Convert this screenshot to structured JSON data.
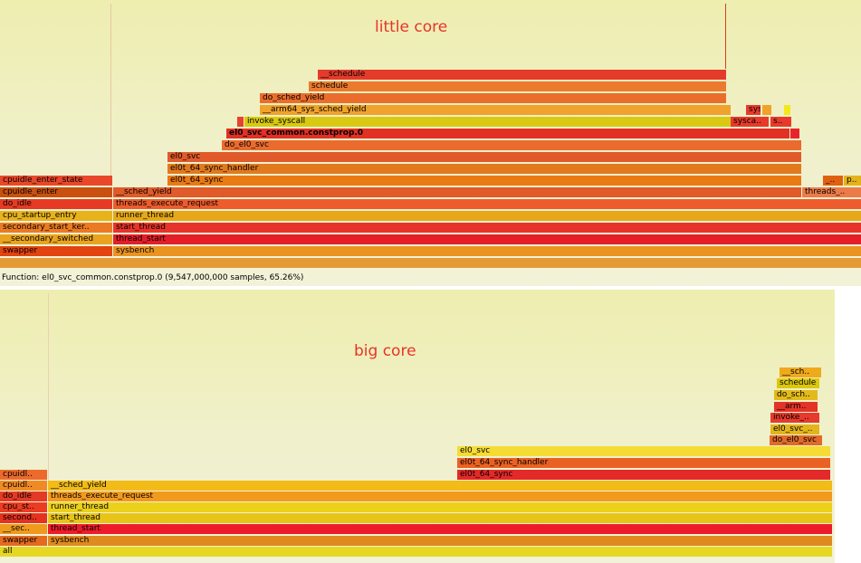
{
  "top": {
    "title": "little core",
    "status": "Function: el0_svc_common.constprop.0 (9,547,000,000 samples, 65.26%)",
    "frames": [
      {
        "label": "__schedule",
        "color": "#e43b2b"
      },
      {
        "label": "schedule",
        "color": "#ec7a2e"
      },
      {
        "label": "do_sched_yield",
        "color": "#ea6d2c"
      },
      {
        "label": "__arm64_sys_sched_yield",
        "color": "#f0a22c"
      },
      {
        "label": "invoke_syscall",
        "color": "#d9c912"
      },
      {
        "label": "sysca..",
        "color": "#e83a2c"
      },
      {
        "label": "s..",
        "color": "#e83a2c"
      },
      {
        "label": "el0_svc_common.constprop.0",
        "color": "#e23025"
      },
      {
        "label": "do_el0_svc",
        "color": "#ea6b2e"
      },
      {
        "label": "el0_svc",
        "color": "#e05a2a"
      },
      {
        "label": "el0t_64_sync_handler",
        "color": "#e27a1d"
      },
      {
        "label": "el0t_64_sync",
        "color": "#ea7a14"
      },
      {
        "label": "_..",
        "color": "#e06010"
      },
      {
        "label": "p..",
        "color": "#e4b31a"
      },
      {
        "label": "cpuidle_enter_state",
        "color": "#e8472a"
      },
      {
        "label": "cpuidle_enter",
        "color": "#c9500f"
      },
      {
        "label": "__sched_yield",
        "color": "#e05a2a"
      },
      {
        "label": "threads_..",
        "color": "#ec7b4a"
      },
      {
        "label": "do_idle",
        "color": "#e63a24"
      },
      {
        "label": "threads_execute_request",
        "color": "#ee5c2d"
      },
      {
        "label": "cpu_startup_entry",
        "color": "#e7b21c"
      },
      {
        "label": "runner_thread",
        "color": "#e6a818"
      },
      {
        "label": "secondary_start_ker..",
        "color": "#ec7a22"
      },
      {
        "label": "start_thread",
        "color": "#e8332a"
      },
      {
        "label": "__secondary_switched",
        "color": "#e9a31e"
      },
      {
        "label": "thread_start",
        "color": "#e41e29"
      },
      {
        "label": "swapper",
        "color": "#e2430f"
      },
      {
        "label": "sysbench",
        "color": "#ea9321"
      },
      {
        "label": "",
        "color": "#e59b35"
      }
    ]
  },
  "bottom": {
    "title": "big core",
    "frames": [
      {
        "label": "__sch..",
        "color": "#efa91c"
      },
      {
        "label": "schedule",
        "color": "#dcc70e"
      },
      {
        "label": "do_sch..",
        "color": "#e2ba1b"
      },
      {
        "label": "__arm..",
        "color": "#e43327"
      },
      {
        "label": "invoke_..",
        "color": "#e53a2d"
      },
      {
        "label": "el0_svc_..",
        "color": "#e2b51c"
      },
      {
        "label": "do_el0_svc",
        "color": "#e06a2a"
      },
      {
        "label": "el0_svc",
        "color": "#f5dc35"
      },
      {
        "label": "el0t_64_sync_handler",
        "color": "#ea6223"
      },
      {
        "label": "el0t_64_sync",
        "color": "#e42929"
      },
      {
        "label": "cpuidl..",
        "color": "#ec6a2c"
      },
      {
        "label": "cpuidl..",
        "color": "#f08a24"
      },
      {
        "label": "__sched_yield",
        "color": "#f2bb18"
      },
      {
        "label": "do_idle",
        "color": "#e43a25"
      },
      {
        "label": "threads_execute_request",
        "color": "#f29a1e"
      },
      {
        "label": "cpu_st..",
        "color": "#ea3c22"
      },
      {
        "label": "runner_thread",
        "color": "#ebd01c"
      },
      {
        "label": "second..",
        "color": "#e4321f"
      },
      {
        "label": "start_thread",
        "color": "#e8c418"
      },
      {
        "label": "__sec..",
        "color": "#ef9a1d"
      },
      {
        "label": "thread_start",
        "color": "#ee1c2a"
      },
      {
        "label": "swapper",
        "color": "#e56a1f"
      },
      {
        "label": "sysbench",
        "color": "#df8a1e"
      },
      {
        "label": "all",
        "color": "#e6d822"
      }
    ]
  }
}
